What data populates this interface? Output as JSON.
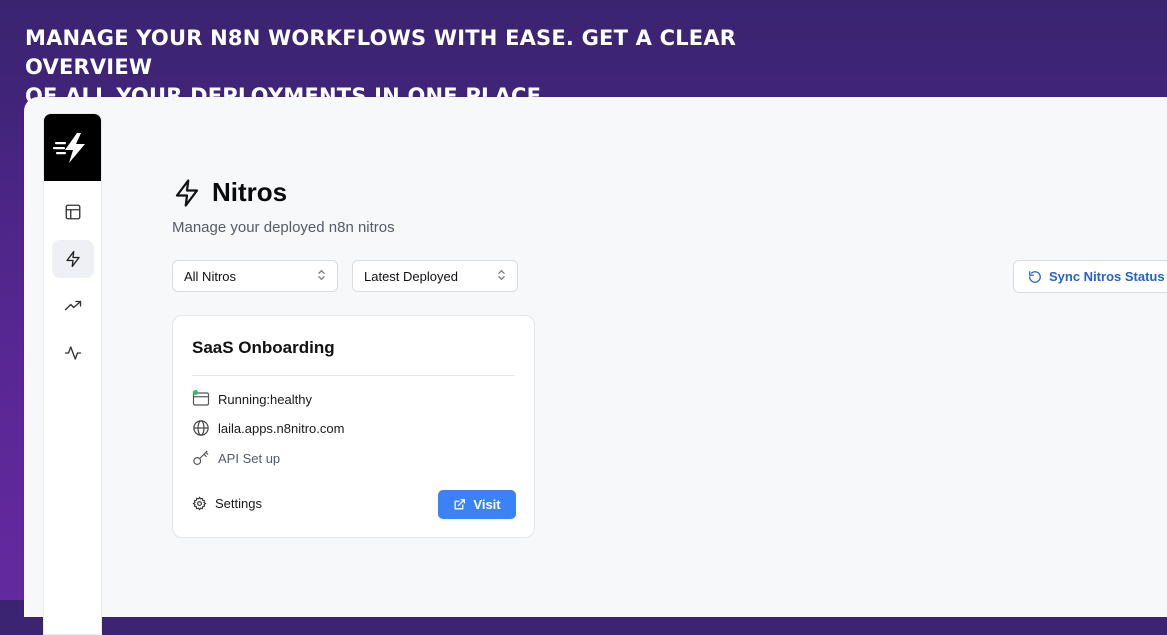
{
  "headline": {
    "line1": "MANAGE YOUR N8N WORKFLOWS WITH EASE. GET A CLEAR OVERVIEW",
    "line2": "OF ALL YOUR DEPLOYMENTS IN ONE PLACE."
  },
  "sidebar": {
    "logo_icon": "lightning-speed-icon",
    "items": [
      {
        "icon": "layout-icon",
        "active": false
      },
      {
        "icon": "lightning-icon",
        "active": true
      },
      {
        "icon": "trending-up-icon",
        "active": false
      },
      {
        "icon": "activity-icon",
        "active": false
      }
    ]
  },
  "page": {
    "title": "Nitros",
    "subtitle": "Manage your deployed n8n nitros"
  },
  "filters": {
    "status_select": "All Nitros",
    "sort_select": "Latest Deployed"
  },
  "sync_button": {
    "label": "Sync Nitros Status"
  },
  "cards": [
    {
      "title": "SaaS Onboarding",
      "status": "Running:healthy",
      "domain": "laila.apps.n8nitro.com",
      "api": "API Set up",
      "settings_label": "Settings",
      "visit_label": "Visit"
    }
  ],
  "colors": {
    "accent": "#3b82f6",
    "link_blue": "#2563c9",
    "status_green": "#22c55e",
    "bg_purple": "#4a2585"
  }
}
